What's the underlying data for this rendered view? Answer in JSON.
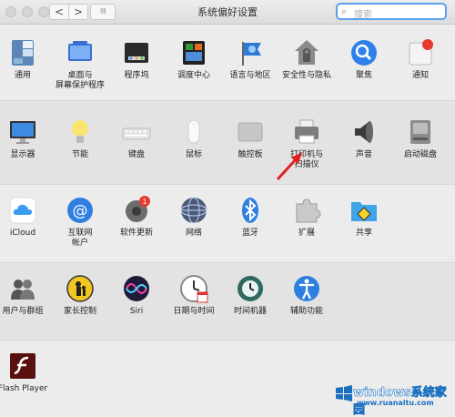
{
  "window": {
    "title": "系统偏好设置"
  },
  "toolbar": {
    "back": "<",
    "forward": ">",
    "grid": "⁝⁝⁝⁝",
    "search_placeholder": "搜索"
  },
  "rows": [
    [
      {
        "label": "通用",
        "icon": "general-icon"
      },
      {
        "label": "桌面与\n屏幕保护程序",
        "icon": "desktop-screensaver-icon"
      },
      {
        "label": "程序坞",
        "icon": "dock-icon"
      },
      {
        "label": "调度中心",
        "icon": "mission-control-icon"
      },
      {
        "label": "语言与地区",
        "icon": "language-region-icon"
      },
      {
        "label": "安全性与隐私",
        "icon": "security-privacy-icon"
      },
      {
        "label": "聚焦",
        "icon": "spotlight-icon"
      },
      {
        "label": "通知",
        "icon": "notifications-icon"
      }
    ],
    [
      {
        "label": "显示器",
        "icon": "displays-icon"
      },
      {
        "label": "节能",
        "icon": "energy-saver-icon"
      },
      {
        "label": "键盘",
        "icon": "keyboard-icon"
      },
      {
        "label": "鼠标",
        "icon": "mouse-icon"
      },
      {
        "label": "触控板",
        "icon": "trackpad-icon"
      },
      {
        "label": "打印机与\n扫描仪",
        "icon": "printers-scanners-icon"
      },
      {
        "label": "声音",
        "icon": "sound-icon"
      },
      {
        "label": "启动磁盘",
        "icon": "startup-disk-icon"
      }
    ],
    [
      {
        "label": "iCloud",
        "icon": "icloud-icon"
      },
      {
        "label": "互联网\n帐户",
        "icon": "internet-accounts-icon"
      },
      {
        "label": "软件更新",
        "icon": "software-update-icon",
        "badge": "1"
      },
      {
        "label": "网络",
        "icon": "network-icon"
      },
      {
        "label": "蓝牙",
        "icon": "bluetooth-icon"
      },
      {
        "label": "扩展",
        "icon": "extensions-icon"
      },
      {
        "label": "共享",
        "icon": "sharing-icon"
      }
    ],
    [
      {
        "label": "用户与群组",
        "icon": "users-groups-icon"
      },
      {
        "label": "家长控制",
        "icon": "parental-controls-icon"
      },
      {
        "label": "Siri",
        "icon": "siri-icon"
      },
      {
        "label": "日期与时间",
        "icon": "date-time-icon"
      },
      {
        "label": "时间机器",
        "icon": "time-machine-icon"
      },
      {
        "label": "辅助功能",
        "icon": "accessibility-icon"
      }
    ],
    [
      {
        "label": "Flash Player",
        "icon": "flash-player-icon"
      }
    ]
  ],
  "watermark": {
    "brand": "windows系统家园",
    "url": "www.ruanaitu.com"
  },
  "colors": {
    "search_focus": "#5aa0f0",
    "badge": "#e8392e",
    "arrow": "#e02020"
  }
}
